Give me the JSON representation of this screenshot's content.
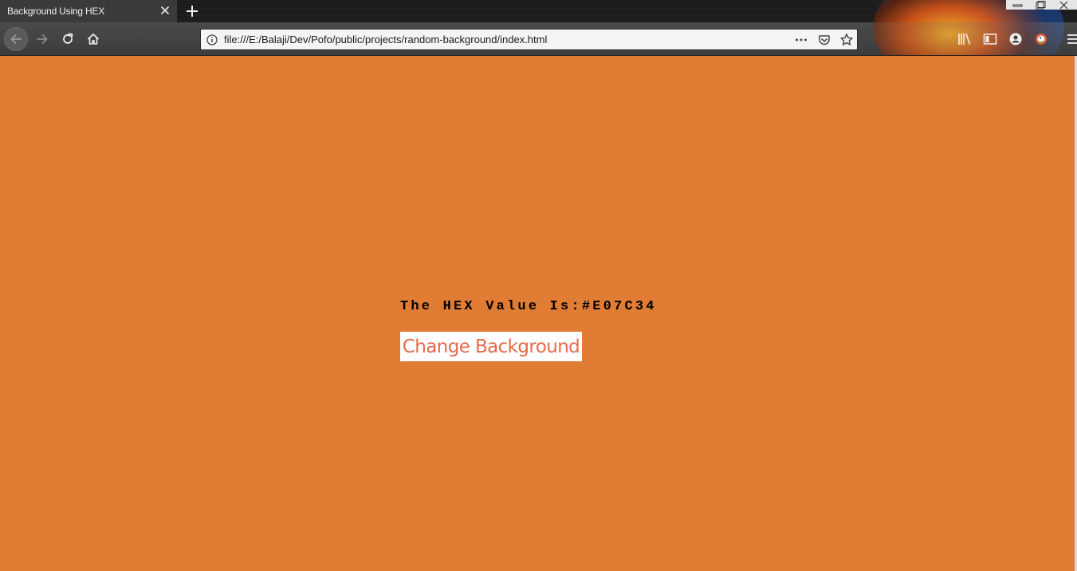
{
  "browser": {
    "tab": {
      "title": "Background Using HEX"
    },
    "address_bar": {
      "url": "file:///E:/Balaji/Dev/Pofo/public/projects/random-background/index.html"
    },
    "icons": {
      "tab_close": "close-icon",
      "new_tab": "plus-icon",
      "back": "back-arrow-icon",
      "forward": "forward-arrow-icon",
      "reload": "reload-icon",
      "home": "home-icon",
      "site_info": "info-icon",
      "page_actions": "more-icon",
      "pocket": "pocket-icon",
      "bookmark": "star-icon",
      "library": "library-icon",
      "sidebar": "sidebar-icon",
      "account": "account-icon",
      "extension": "duckduckgo-icon",
      "menu": "hamburger-menu-icon"
    }
  },
  "page": {
    "background_color": "#E07C34",
    "hex_label": "The HEX Value Is:",
    "hex_value": "#E07C34",
    "button_label": "Change Background",
    "button_text_color": "#E8684A"
  }
}
